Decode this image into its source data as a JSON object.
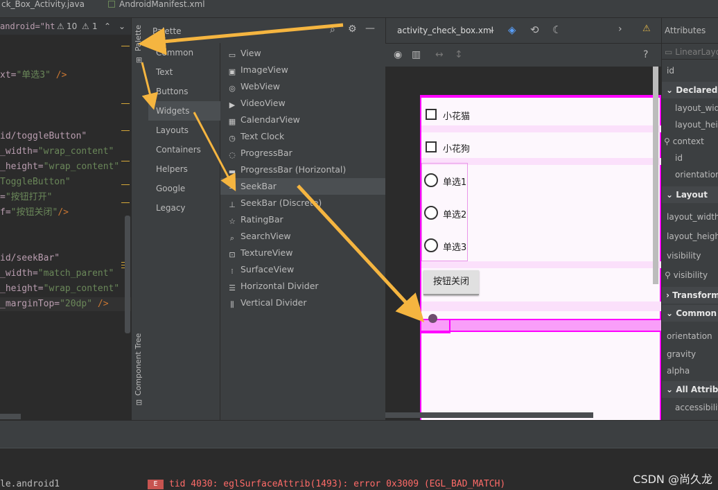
{
  "file_tabs": [
    {
      "label": "ck_Box_Activity.java"
    },
    {
      "label": "AndroidManifest.xml"
    }
  ],
  "editor": {
    "hint_code": "android=\"ht",
    "warnings": "10",
    "weak_warnings": "1",
    "lines": [
      {
        "attr": "xt=",
        "str": "\"单选3\"",
        "punc": " />"
      },
      {
        "attr": "id/toggleButton\"",
        "str": "",
        "punc": ""
      },
      {
        "attr": "_width=",
        "str": "\"wrap_content\"",
        "punc": ""
      },
      {
        "attr": "_height=",
        "str": "\"wrap_content\"",
        "punc": ""
      },
      {
        "attr": "ToggleButton\"",
        "str": "",
        "punc": ""
      },
      {
        "attr": "=",
        "str": "\"按钮打开\"",
        "punc": ""
      },
      {
        "attr": "f=",
        "str": "\"按钮关闭\"",
        "punc": "/>"
      },
      {
        "attr": "id/seekBar\"",
        "str": "",
        "punc": ""
      },
      {
        "attr": "_width=",
        "str": "\"match_parent\"",
        "punc": ""
      },
      {
        "attr": "_height=",
        "str": "\"wrap_content\"",
        "punc": ""
      },
      {
        "attr": "_marginTop=",
        "str": "\"20dp\"",
        "punc": " />"
      }
    ]
  },
  "side_strip": {
    "palette": "Palette",
    "component_tree": "Component Tree"
  },
  "palette": {
    "title": "Palette",
    "categories": [
      "Common",
      "Text",
      "Buttons",
      "Widgets",
      "Layouts",
      "Containers",
      "Helpers",
      "Google",
      "Legacy"
    ],
    "selected_category": "Widgets",
    "items": [
      {
        "icon": "view-icon",
        "label": "View"
      },
      {
        "icon": "imageview-icon",
        "label": "ImageView"
      },
      {
        "icon": "webview-icon",
        "label": "WebView"
      },
      {
        "icon": "videoview-icon",
        "label": "VideoView"
      },
      {
        "icon": "calendarview-icon",
        "label": "CalendarView"
      },
      {
        "icon": "textclock-icon",
        "label": "Text Clock"
      },
      {
        "icon": "progressbar-icon",
        "label": "ProgressBar"
      },
      {
        "icon": "progressbar-horizontal-icon",
        "label": "ProgressBar (Horizontal)"
      },
      {
        "icon": "seekbar-icon",
        "label": "SeekBar"
      },
      {
        "icon": "seekbar-discrete-icon",
        "label": "SeekBar (Discrete)"
      },
      {
        "icon": "ratingbar-icon",
        "label": "RatingBar"
      },
      {
        "icon": "searchview-icon",
        "label": "SearchView"
      },
      {
        "icon": "textureview-icon",
        "label": "TextureView"
      },
      {
        "icon": "surfaceview-icon",
        "label": "SurfaceView"
      },
      {
        "icon": "horizontal-divider-icon",
        "label": "Horizontal Divider"
      },
      {
        "icon": "vertical-divider-icon",
        "label": "Vertical Divider"
      }
    ],
    "selected_item": "SeekBar"
  },
  "design": {
    "file_name": "activity_check_box.xml",
    "help": "?",
    "widgets": {
      "checkbox1": "小花猫",
      "checkbox2": "小花狗",
      "radio1": "单选1",
      "radio2": "单选2",
      "radio3": "单选3",
      "toggle_button": "按钮关闭"
    }
  },
  "attributes": {
    "title": "Attributes",
    "component": "LinearLayo",
    "rows": [
      {
        "label": "id",
        "type": "plain"
      },
      {
        "label": "Declared A",
        "type": "section"
      },
      {
        "label": "layout_width",
        "type": "sub"
      },
      {
        "label": "layout_heigh",
        "type": "sub"
      },
      {
        "label": "context",
        "type": "tool"
      },
      {
        "label": "id",
        "type": "sub"
      },
      {
        "label": "orientation",
        "type": "sub"
      },
      {
        "label": "Layout",
        "type": "section"
      },
      {
        "label": "layout_width",
        "type": "plain"
      },
      {
        "label": "layout_height",
        "type": "plain"
      },
      {
        "label": "visibility",
        "type": "plain"
      },
      {
        "label": "visibility",
        "type": "tool"
      },
      {
        "label": "Transform",
        "type": "section-collapsed"
      },
      {
        "label": "Common",
        "type": "section"
      },
      {
        "label": "orientation",
        "type": "plain"
      },
      {
        "label": "gravity",
        "type": "plain"
      },
      {
        "label": "alpha",
        "type": "plain"
      },
      {
        "label": "All Attribu",
        "type": "section"
      },
      {
        "label": "accessibility",
        "type": "sub"
      }
    ]
  },
  "log": {
    "process": "le.android1",
    "level": "E",
    "message": "tid 4030: eglSurfaceAttrib(1493): error 0x3009 (EGL_BAD_MATCH)"
  },
  "watermark": "CSDN @尚久龙",
  "colors": {
    "accent": "#ff00ff",
    "arrow": "#f5b540",
    "error": "#c75450"
  }
}
